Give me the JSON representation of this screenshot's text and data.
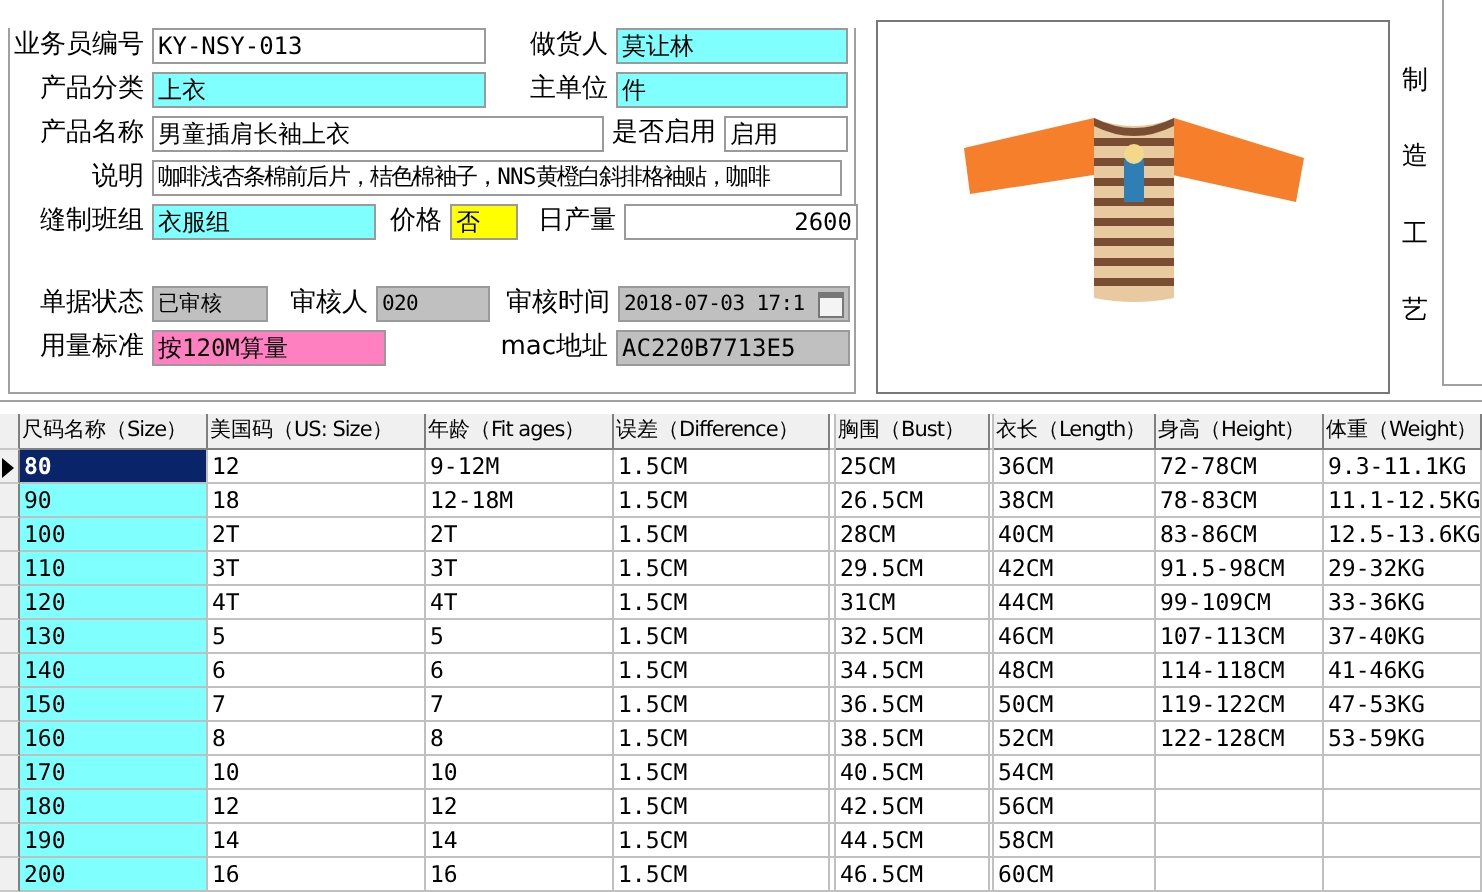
{
  "form": {
    "rows": [
      {
        "fields": [
          {
            "label": "业务员编号",
            "value": "KY-NSY-013",
            "color": "#ffffff",
            "kind": "text"
          },
          {
            "label": "做货人",
            "value": "莫让林",
            "color": "#80ffff",
            "kind": "text"
          }
        ]
      },
      {
        "fields": [
          {
            "label": "产品分类",
            "value": "上衣",
            "color": "#80ffff",
            "kind": "text"
          },
          {
            "label": "主单位",
            "value": "件",
            "color": "#80ffff",
            "kind": "text"
          }
        ]
      },
      {
        "fields": [
          {
            "label": "产品名称",
            "value": "男童插肩长袖上衣",
            "color": "#ffffff",
            "kind": "text"
          },
          {
            "label": "是否启用",
            "value": "启用",
            "color": "#ffffff",
            "kind": "text"
          }
        ]
      },
      {
        "fields": [
          {
            "label": "说明",
            "value": "咖啡浅杏条棉前后片，桔色棉袖子，NNS黄橙白斜排格袖贴，咖啡",
            "color": "#ffffff",
            "kind": "text"
          }
        ]
      },
      {
        "fields": [
          {
            "label": "缝制班组",
            "value": "衣服组",
            "color": "#80ffff",
            "kind": "text"
          },
          {
            "label": "价格",
            "value": "否",
            "color": "#ffff00",
            "kind": "text"
          },
          {
            "label": "日产量",
            "value": "2600",
            "color": "#ffffff",
            "kind": "number"
          }
        ]
      },
      {
        "fields": [
          {
            "label": "单据状态",
            "value": "已审核",
            "color": "#c0c0c0",
            "kind": "text"
          },
          {
            "label": "审核人",
            "value": "020",
            "color": "#c0c0c0",
            "kind": "text"
          },
          {
            "label": "审核时间",
            "value": "2018-07-03  17:1",
            "color": "#c0c0c0",
            "kind": "date"
          }
        ]
      },
      {
        "fields": [
          {
            "label": "用量标准",
            "value": "按120M算量",
            "color": "#ff80c0",
            "kind": "text"
          },
          {
            "label": "mac地址",
            "value": "AC220B7713E5",
            "color": "#c0c0c0",
            "kind": "text"
          }
        ]
      }
    ]
  },
  "side_label": "制造工艺",
  "table": {
    "columns": [
      {
        "label": "尺码名称（Size）",
        "kind": "text",
        "color": "#80ffff"
      },
      {
        "label": "美国码（US: Size）",
        "kind": "text"
      },
      {
        "label": "年龄（Fit ages）",
        "kind": "text"
      },
      {
        "label": "误差（Difference）",
        "kind": "text"
      },
      {
        "kind": "collapsed"
      },
      {
        "label": "胸围（Bust）",
        "kind": "text"
      },
      {
        "kind": "collapsed"
      },
      {
        "label": "衣长（Length）",
        "kind": "text"
      },
      {
        "label": "身高（Height）",
        "kind": "text"
      },
      {
        "label": "体重（Weight）",
        "kind": "text"
      }
    ],
    "rows": [
      {
        "selected": true,
        "cells": [
          "80",
          "12",
          "9-12M",
          "1.5CM",
          "",
          "25CM",
          "",
          "36CM",
          "72-78CM",
          "9.3-11.1KG"
        ]
      },
      {
        "selected": false,
        "cells": [
          "90",
          "18",
          "12-18M",
          "1.5CM",
          "",
          "26.5CM",
          "",
          "38CM",
          "78-83CM",
          "11.1-12.5KG"
        ]
      },
      {
        "selected": false,
        "cells": [
          "100",
          "2T",
          "2T",
          "1.5CM",
          "",
          "28CM",
          "",
          "40CM",
          "83-86CM",
          "12.5-13.6KG"
        ]
      },
      {
        "selected": false,
        "cells": [
          "110",
          "3T",
          "3T",
          "1.5CM",
          "",
          "29.5CM",
          "",
          "42CM",
          "91.5-98CM",
          "29-32KG"
        ]
      },
      {
        "selected": false,
        "cells": [
          "120",
          "4T",
          "4T",
          "1.5CM",
          "",
          "31CM",
          "",
          "44CM",
          "99-109CM",
          "33-36KG"
        ]
      },
      {
        "selected": false,
        "cells": [
          "130",
          "5",
          "5",
          "1.5CM",
          "",
          "32.5CM",
          "",
          "46CM",
          "107-113CM",
          "37-40KG"
        ]
      },
      {
        "selected": false,
        "cells": [
          "140",
          "6",
          "6",
          "1.5CM",
          "",
          "34.5CM",
          "",
          "48CM",
          "114-118CM",
          "41-46KG"
        ]
      },
      {
        "selected": false,
        "cells": [
          "150",
          "7",
          "7",
          "1.5CM",
          "",
          "36.5CM",
          "",
          "50CM",
          "119-122CM",
          "47-53KG"
        ]
      },
      {
        "selected": false,
        "cells": [
          "160",
          "8",
          "8",
          "1.5CM",
          "",
          "38.5CM",
          "",
          "52CM",
          "122-128CM",
          "53-59KG"
        ]
      },
      {
        "selected": false,
        "cells": [
          "170",
          "10",
          "10",
          "1.5CM",
          "",
          "40.5CM",
          "",
          "54CM",
          "",
          ""
        ]
      },
      {
        "selected": false,
        "cells": [
          "180",
          "12",
          "12",
          "1.5CM",
          "",
          "42.5CM",
          "",
          "56CM",
          "",
          ""
        ]
      },
      {
        "selected": false,
        "cells": [
          "190",
          "14",
          "14",
          "1.5CM",
          "",
          "44.5CM",
          "",
          "58CM",
          "",
          ""
        ]
      },
      {
        "selected": false,
        "cells": [
          "200",
          "16",
          "16",
          "1.5CM",
          "",
          "46.5CM",
          "",
          "60CM",
          "",
          ""
        ]
      }
    ]
  }
}
